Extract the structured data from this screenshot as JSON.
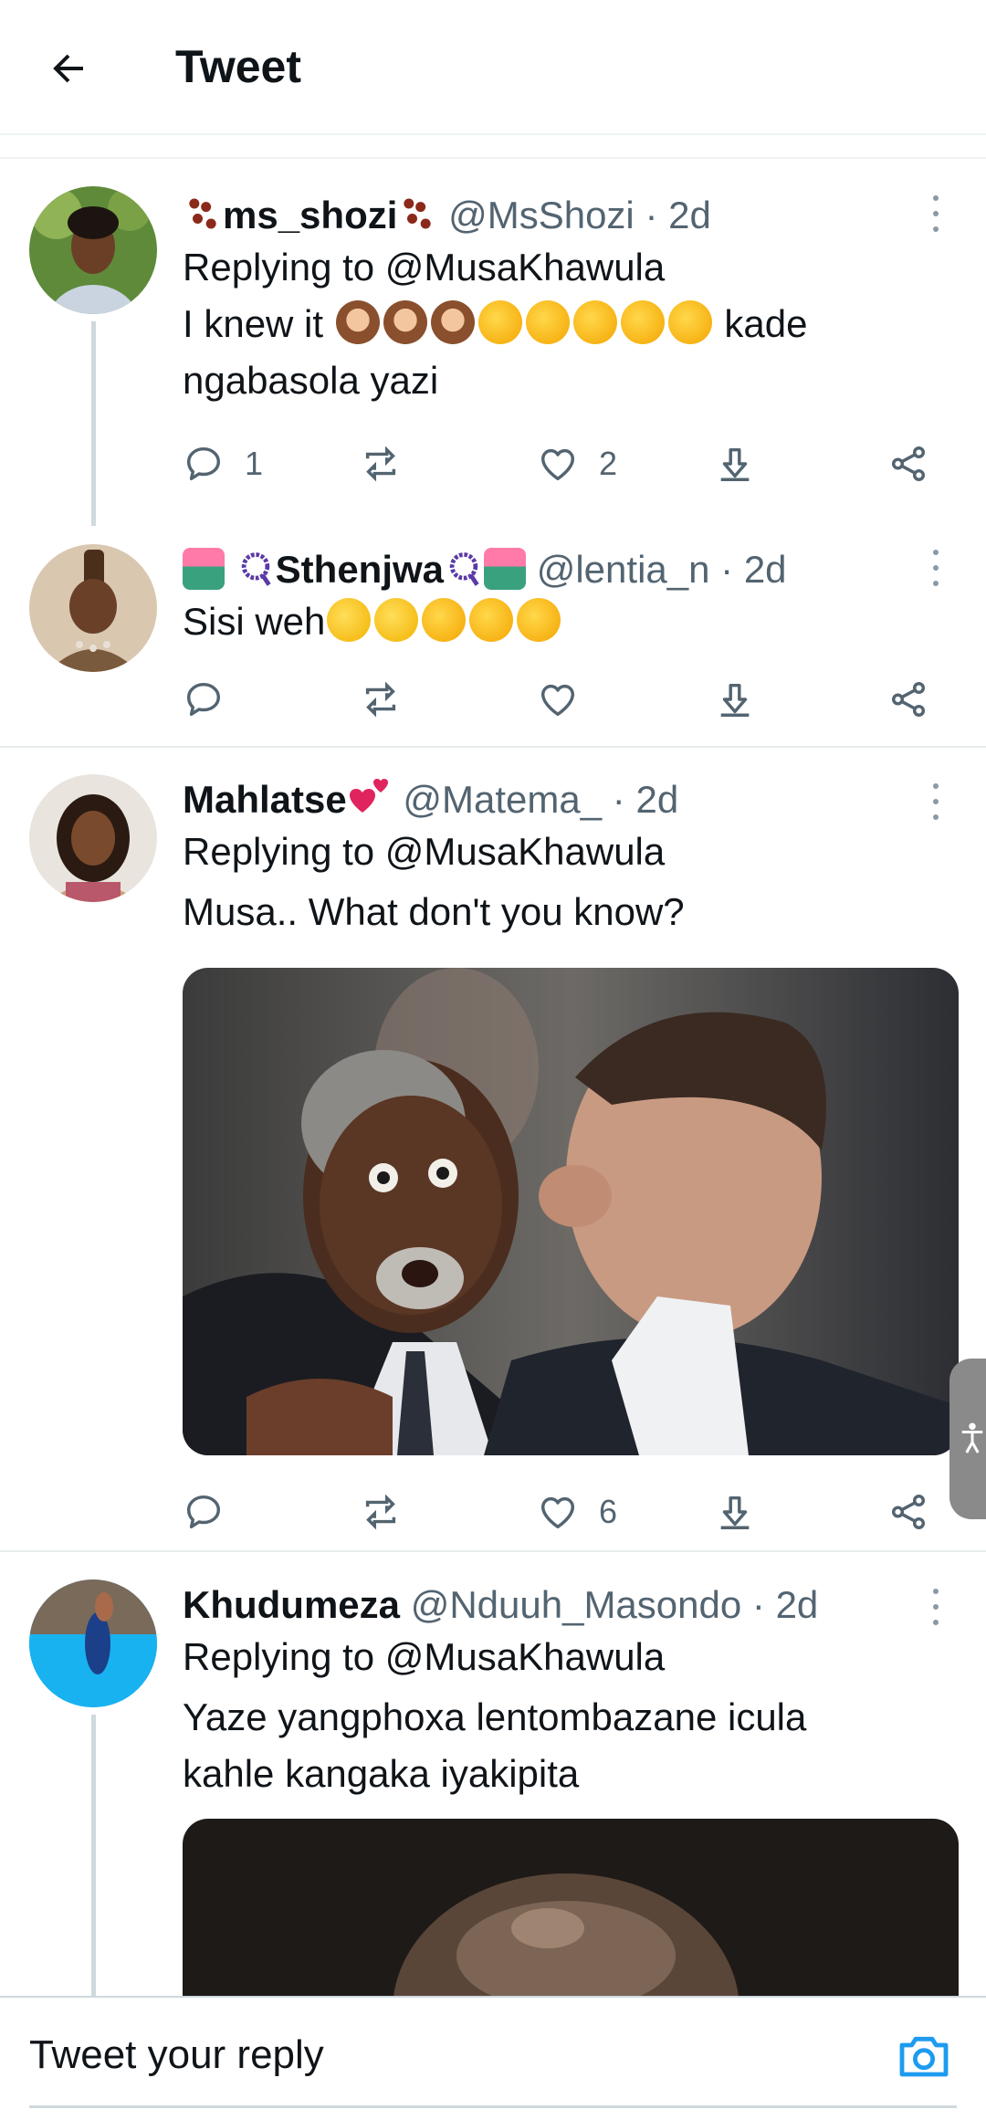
{
  "header": {
    "title": "Tweet"
  },
  "tweets": [
    {
      "name": "ms_shozi",
      "handle": "@MsShozi",
      "separator": "·",
      "time": "2d",
      "replying_to": "Replying to @MusaKhawula",
      "text_a": "I knew it",
      "text_b": "kade",
      "text_c": "ngabasola yazi",
      "reply_count": "1",
      "retweet_count": "",
      "like_count": "2"
    },
    {
      "name": "Sthenjwa",
      "handle": "@lentia_n",
      "separator": "·",
      "time": "2d",
      "text_a": "Sisi weh",
      "reply_count": "",
      "retweet_count": "",
      "like_count": ""
    },
    {
      "name": "Mahlatse",
      "handle": "@Matema_",
      "separator": "·",
      "time": "2d",
      "replying_to": "Replying to @MusaKhawula",
      "text_a": "Musa.. What don't you know?",
      "reply_count": "",
      "retweet_count": "",
      "like_count": "6"
    },
    {
      "name": "Khudumeza",
      "handle": "@Nduuh_Masondo",
      "separator": "·",
      "time": "2d",
      "replying_to": "Replying to @MusaKhawula",
      "text_a": "Yaze yangphoxa lentombazane icula",
      "text_b": "kahle kangaka iyakipita"
    }
  ],
  "reply_bar": {
    "placeholder": "Tweet your reply"
  },
  "icons": {
    "back": "arrow-left-icon",
    "more": "more-vertical-icon",
    "reply": "reply-icon",
    "retweet": "retweet-icon",
    "like": "heart-icon",
    "download": "download-icon",
    "share": "share-icon",
    "camera": "camera-icon",
    "accessibility": "accessibility-icon"
  },
  "colors": {
    "accent": "#1d9bf0",
    "muted": "#536471",
    "divider": "#eff3f4"
  }
}
